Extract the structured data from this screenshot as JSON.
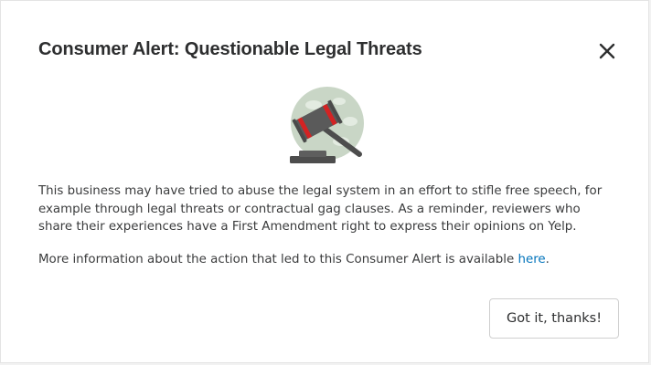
{
  "dialog": {
    "title": "Consumer Alert: Questionable Legal Threats",
    "close_icon": "close-icon",
    "illustration_icon": "gavel-icon",
    "paragraph1": "This business may have tried to abuse the legal system in an effort to stifle free speech, for example through legal threats or contractual gag clauses. As a reminder, reviewers who share their experiences have a First Amendment right to express their opinions on Yelp.",
    "paragraph2_text": "More information about the action that led to this Consumer Alert is available ",
    "paragraph2_link": "here",
    "paragraph2_end": ".",
    "confirm_button": "Got it, thanks!"
  },
  "colors": {
    "title": "#2d2e2f",
    "body_text": "#3a3b3c",
    "link": "#0073bb",
    "gavel_red": "#d32323",
    "gavel_dark": "#4d4d4d",
    "circle_bg": "#c9d6c6"
  }
}
